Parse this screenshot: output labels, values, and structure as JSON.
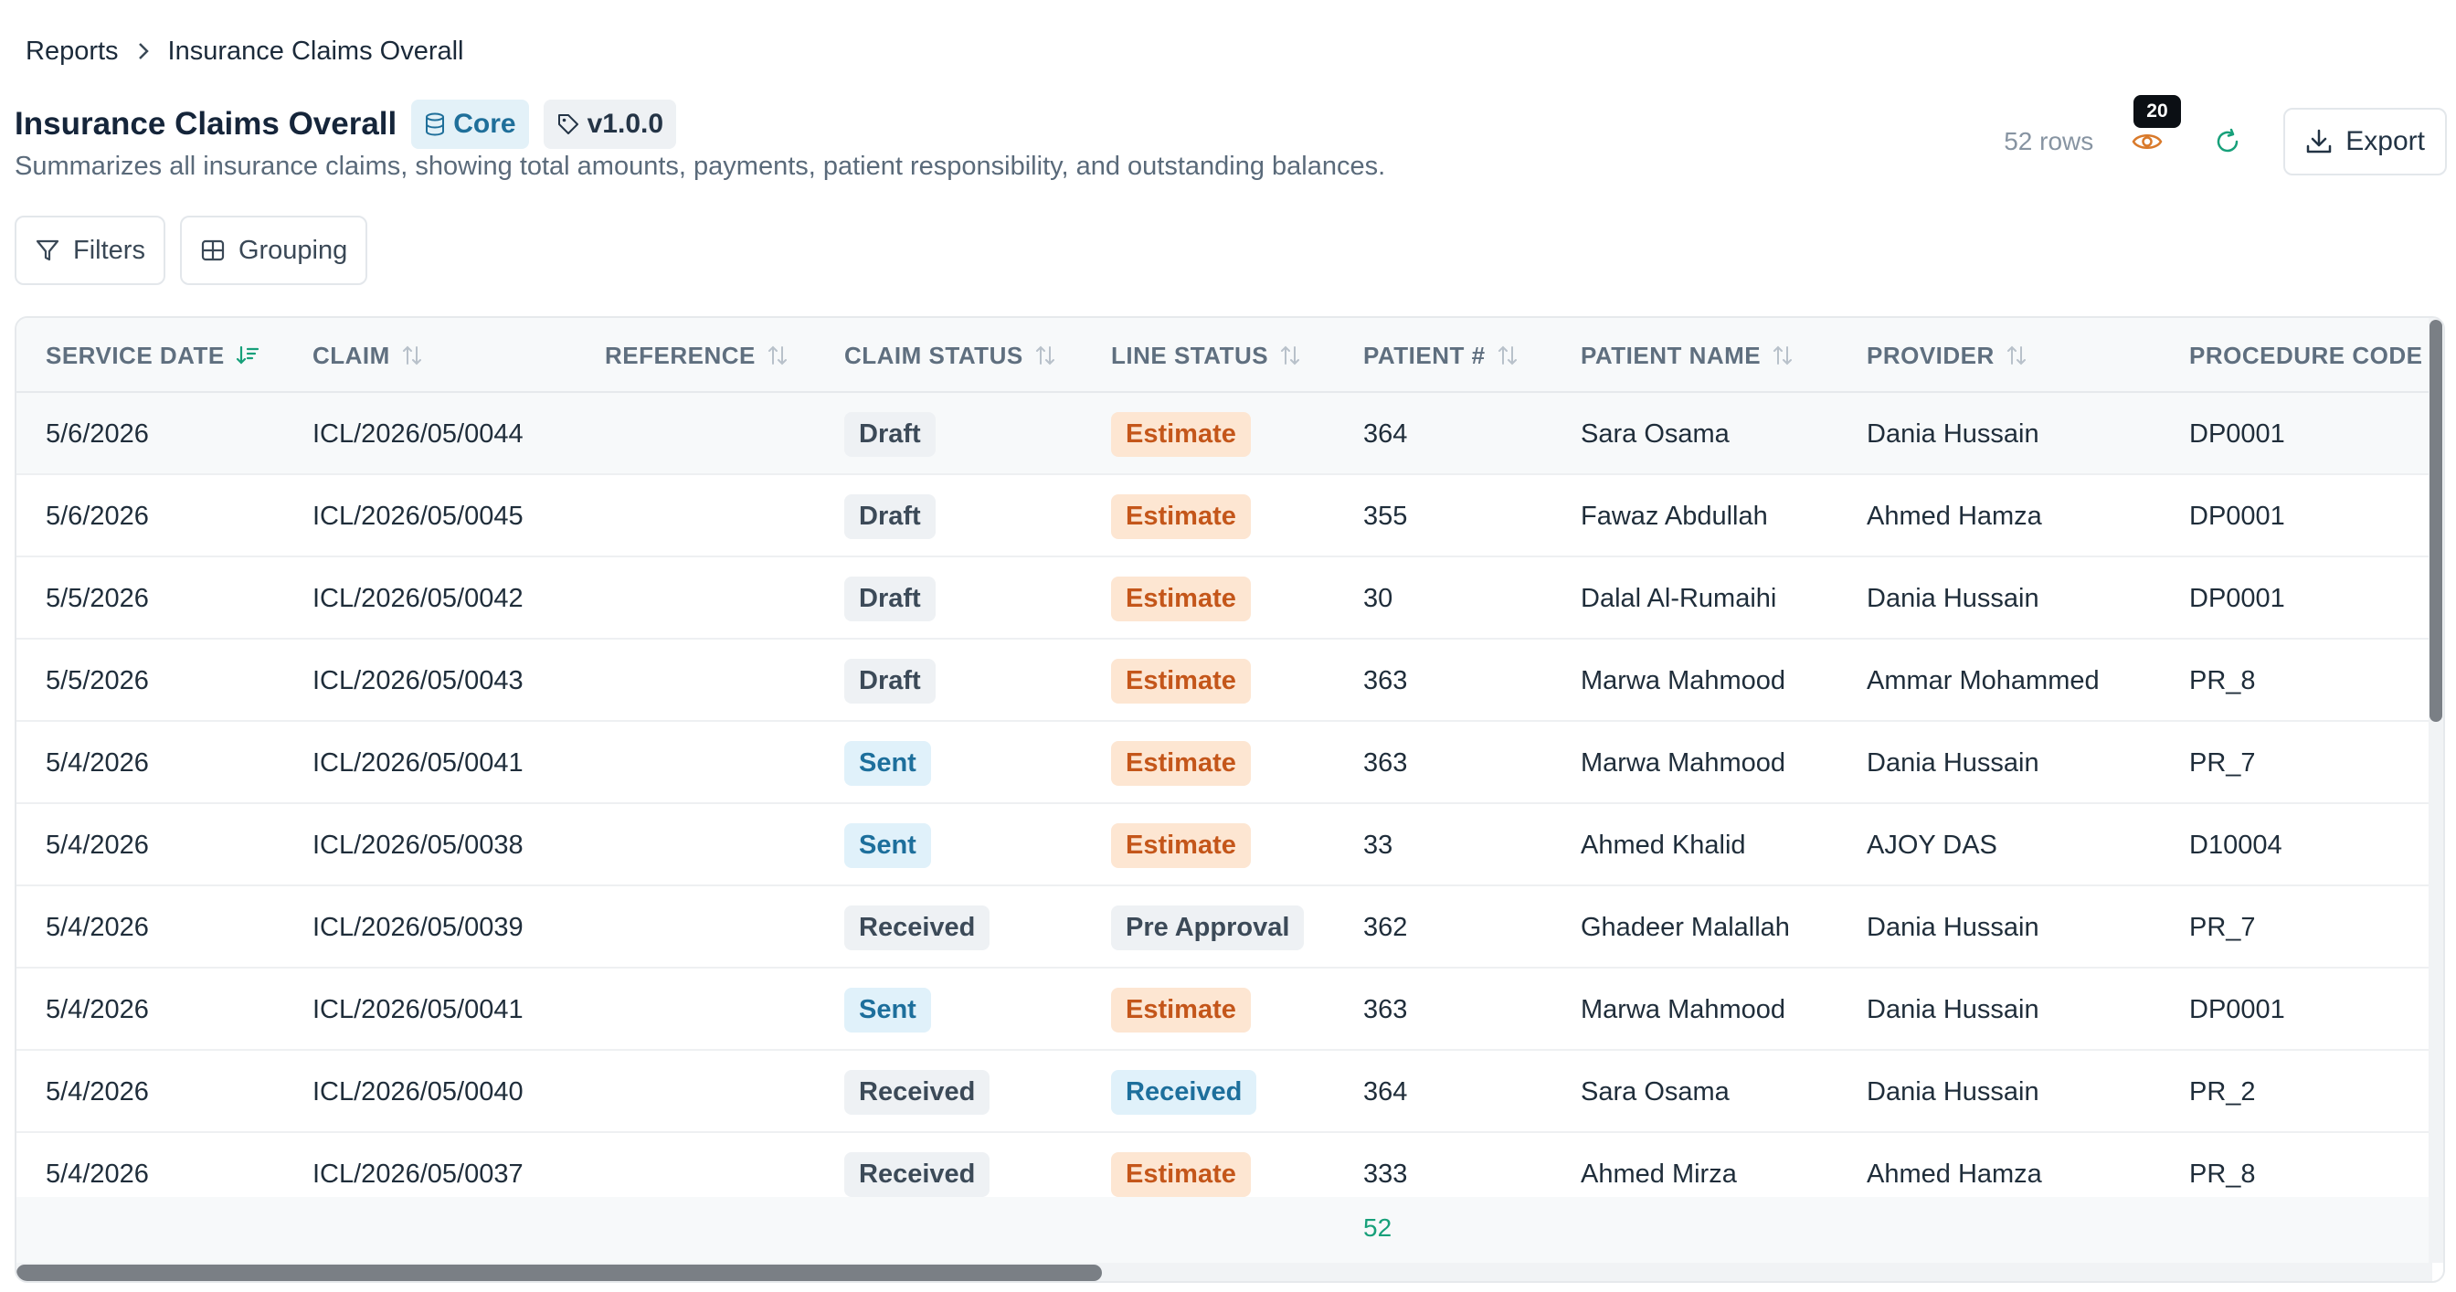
{
  "breadcrumb": {
    "parent": "Reports",
    "current": "Insurance Claims Overall"
  },
  "header": {
    "title": "Insurance Claims Overall",
    "tag_core": "Core",
    "tag_version": "v1.0.0",
    "subtitle": "Summarizes all insurance claims, showing total amounts, payments, patient responsibility, and outstanding balances.",
    "rows_label": "52 rows",
    "visibility_count": "20",
    "export_label": "Export"
  },
  "toolbar": {
    "filters_label": "Filters",
    "grouping_label": "Grouping"
  },
  "colors": {
    "accent": "#17a07a",
    "estimate": "#c4561a",
    "sent": "#1d6f9c"
  },
  "table": {
    "columns": [
      "SERVICE DATE",
      "CLAIM",
      "REFERENCE",
      "CLAIM STATUS",
      "LINE STATUS",
      "PATIENT #",
      "PATIENT NAME",
      "PROVIDER",
      "PROCEDURE CODE"
    ],
    "sorted_column": "SERVICE DATE",
    "rows": [
      {
        "service_date": "5/6/2026",
        "claim": "ICL/2026/05/0044",
        "reference": "",
        "claim_status": "Draft",
        "line_status": "Estimate",
        "patient_no": "364",
        "patient_name": "Sara Osama",
        "provider": "Dania Hussain",
        "procedure_code": "DP0001"
      },
      {
        "service_date": "5/6/2026",
        "claim": "ICL/2026/05/0045",
        "reference": "",
        "claim_status": "Draft",
        "line_status": "Estimate",
        "patient_no": "355",
        "patient_name": "Fawaz Abdullah",
        "provider": "Ahmed Hamza",
        "procedure_code": "DP0001"
      },
      {
        "service_date": "5/5/2026",
        "claim": "ICL/2026/05/0042",
        "reference": "",
        "claim_status": "Draft",
        "line_status": "Estimate",
        "patient_no": "30",
        "patient_name": "Dalal Al-Rumaihi",
        "provider": "Dania Hussain",
        "procedure_code": "DP0001"
      },
      {
        "service_date": "5/5/2026",
        "claim": "ICL/2026/05/0043",
        "reference": "",
        "claim_status": "Draft",
        "line_status": "Estimate",
        "patient_no": "363",
        "patient_name": "Marwa Mahmood",
        "provider": "Ammar Mohammed",
        "procedure_code": "PR_8"
      },
      {
        "service_date": "5/4/2026",
        "claim": "ICL/2026/05/0041",
        "reference": "",
        "claim_status": "Sent",
        "line_status": "Estimate",
        "patient_no": "363",
        "patient_name": "Marwa Mahmood",
        "provider": "Dania Hussain",
        "procedure_code": "PR_7"
      },
      {
        "service_date": "5/4/2026",
        "claim": "ICL/2026/05/0038",
        "reference": "",
        "claim_status": "Sent",
        "line_status": "Estimate",
        "patient_no": "33",
        "patient_name": "Ahmed Khalid",
        "provider": "AJOY DAS",
        "procedure_code": "D10004"
      },
      {
        "service_date": "5/4/2026",
        "claim": "ICL/2026/05/0039",
        "reference": "",
        "claim_status": "Received",
        "line_status": "Pre Approval",
        "patient_no": "362",
        "patient_name": "Ghadeer Malallah",
        "provider": "Dania Hussain",
        "procedure_code": "PR_7"
      },
      {
        "service_date": "5/4/2026",
        "claim": "ICL/2026/05/0041",
        "reference": "",
        "claim_status": "Sent",
        "line_status": "Estimate",
        "patient_no": "363",
        "patient_name": "Marwa Mahmood",
        "provider": "Dania Hussain",
        "procedure_code": "DP0001"
      },
      {
        "service_date": "5/4/2026",
        "claim": "ICL/2026/05/0040",
        "reference": "",
        "claim_status": "Received",
        "line_status": "Received",
        "patient_no": "364",
        "patient_name": "Sara Osama",
        "provider": "Dania Hussain",
        "procedure_code": "PR_2"
      },
      {
        "service_date": "5/4/2026",
        "claim": "ICL/2026/05/0037",
        "reference": "",
        "claim_status": "Received",
        "line_status": "Estimate",
        "patient_no": "333",
        "patient_name": "Ahmed Mirza",
        "provider": "Ahmed Hamza",
        "procedure_code": "PR_8"
      }
    ],
    "footer_count": "52"
  }
}
